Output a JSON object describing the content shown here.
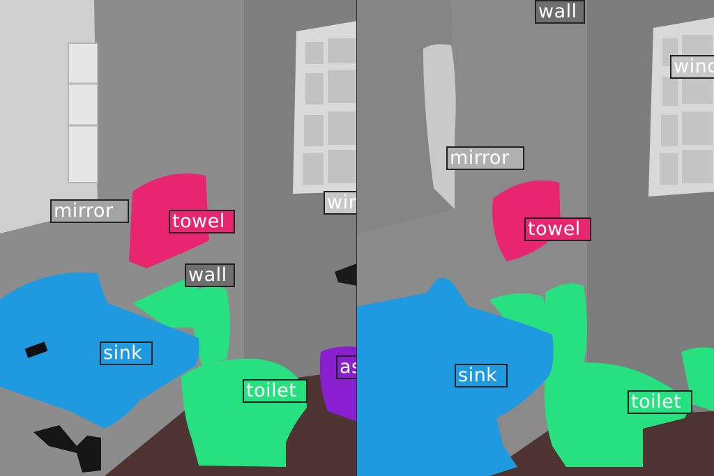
{
  "colors": {
    "wall": "#8a8a8a",
    "window": "#d8d8d8",
    "mirror": "#c9c9c9",
    "towel": "#e8266f",
    "sink": "#1f9ae0",
    "toilet": "#27e07f",
    "floor": "#4d3432",
    "purple": "#8a1fd0"
  },
  "left_panel": {
    "labels": {
      "mirror": "mirror",
      "towel": "towel",
      "wall": "wall",
      "sink": "sink",
      "toilet": "toilet",
      "window_partial": "win",
      "partial_as": "as"
    }
  },
  "right_panel": {
    "labels": {
      "wall": "wall",
      "window_partial": "wind",
      "mirror": "mirror",
      "towel": "towel",
      "sink": "sink",
      "toilet": "toilet"
    }
  }
}
